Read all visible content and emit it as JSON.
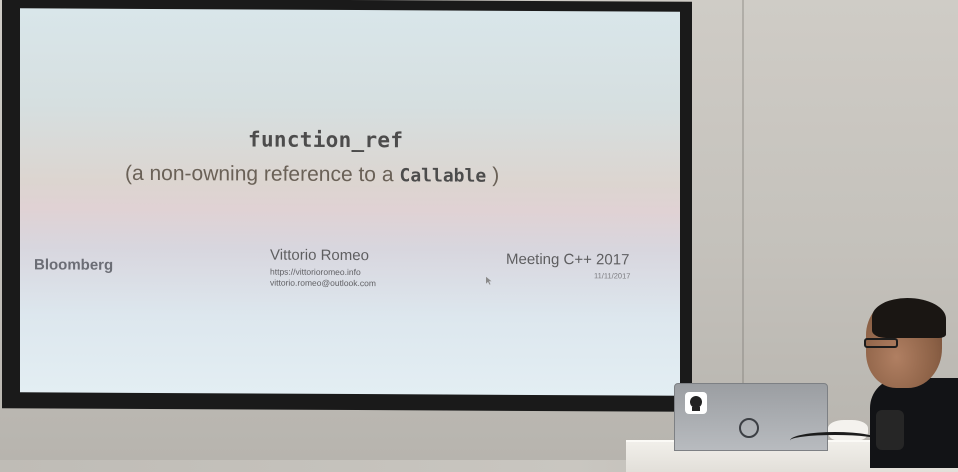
{
  "slide": {
    "title": "function_ref",
    "subtitle_prefix": "(a non-owning reference to a",
    "subtitle_code": "Callable",
    "subtitle_suffix": ")",
    "company_logo": "Bloomberg",
    "author": {
      "name": "Vittorio Romeo",
      "website": "https://vittorioromeo.info",
      "email": "vittorio.romeo@outlook.com"
    },
    "event": {
      "name": "Meeting C++ 2017",
      "date": "11/11/2017"
    }
  },
  "colors": {
    "screen_top": "#d9e6ea",
    "screen_bottom": "#e3eef3",
    "title_text": "#4c4c4c",
    "subtitle_text": "#6a6157",
    "frame": "#1a1a1a"
  },
  "icons": {
    "laptop_brand": "dell-logo-icon",
    "cursor": "mouse-cursor-icon"
  }
}
